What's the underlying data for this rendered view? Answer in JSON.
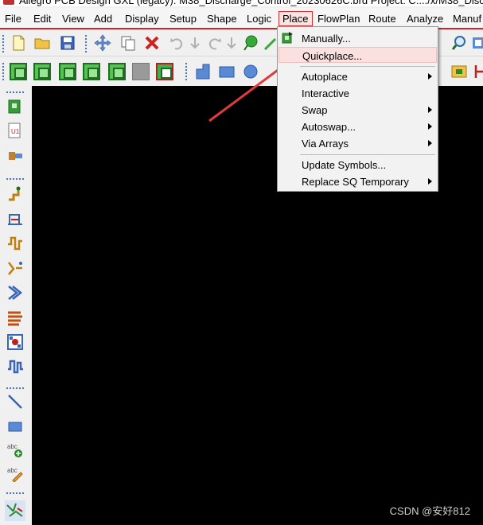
{
  "window": {
    "title": "Allegro PCB Design GXL (legacy): M38_Discharge_Control_20230626C.brd  Project: C:.../x/M38_Disch"
  },
  "menubar": {
    "items": [
      "File",
      "Edit",
      "View",
      "Add",
      "Display",
      "Setup",
      "Shape",
      "Logic",
      "Place",
      "FlowPlan",
      "Route",
      "Analyze",
      "Manuf"
    ],
    "active": "Place"
  },
  "place_menu": {
    "items": [
      {
        "label": "Manually...",
        "submenu": false
      },
      {
        "label": "Quickplace...",
        "submenu": false,
        "highlighted": true
      },
      {
        "label": "Autoplace",
        "submenu": true
      },
      {
        "label": "Interactive",
        "submenu": false
      },
      {
        "label": "Swap",
        "submenu": true
      },
      {
        "label": "Autoswap...",
        "submenu": true
      },
      {
        "label": "Via Arrays",
        "submenu": true
      },
      {
        "label": "Update Symbols...",
        "submenu": false
      },
      {
        "label": "Replace SQ Temporary",
        "submenu": true
      }
    ]
  },
  "watermark": "CSDN @安好812",
  "colors": {
    "canvas": "#000000",
    "accent_red": "#d03030",
    "highlight": "#fbe0e0"
  }
}
